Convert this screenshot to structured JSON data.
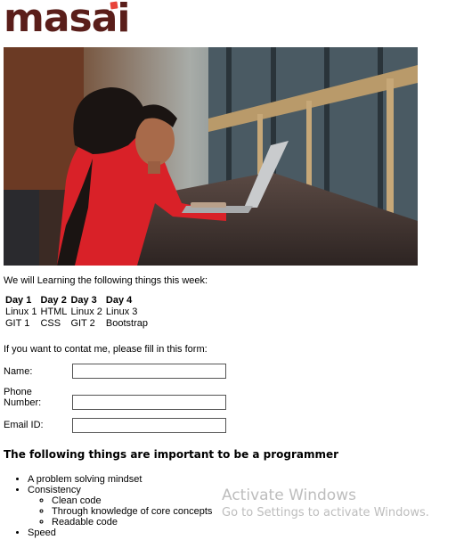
{
  "logo": {
    "text": "masai"
  },
  "intro": "We will Learning the following things this week:",
  "schedule": {
    "headers": [
      "Day 1",
      "Day 2",
      "Day 3",
      "Day 4"
    ],
    "rows": [
      [
        "Linux 1",
        "HTML",
        "Linux 2",
        "Linux 3"
      ],
      [
        "GIT 1",
        "CSS",
        "GIT 2",
        "Bootstrap"
      ]
    ]
  },
  "form": {
    "prompt": "If you want to contat me, please fill in this form:",
    "name_label": "Name:",
    "phone_label_1": "Phone",
    "phone_label_2": "Number:",
    "email_label": "Email ID:",
    "name_value": "",
    "phone_value": "",
    "email_value": ""
  },
  "important": {
    "heading": "The following things are important to be a programmer",
    "items": {
      "i0": "A problem solving mindset",
      "i1": "Consistency",
      "sub0": "Clean code",
      "sub1": "Through knowledge of core concepts",
      "sub2": "Readable code",
      "i2": "Speed"
    }
  },
  "watermark": {
    "line1": "Activate Windows",
    "line2": "Go to Settings to activate Windows."
  },
  "colors": {
    "logo": "#5a1e1a",
    "logo_dot": "#e8443a",
    "watermark": "#bdbdbd"
  }
}
